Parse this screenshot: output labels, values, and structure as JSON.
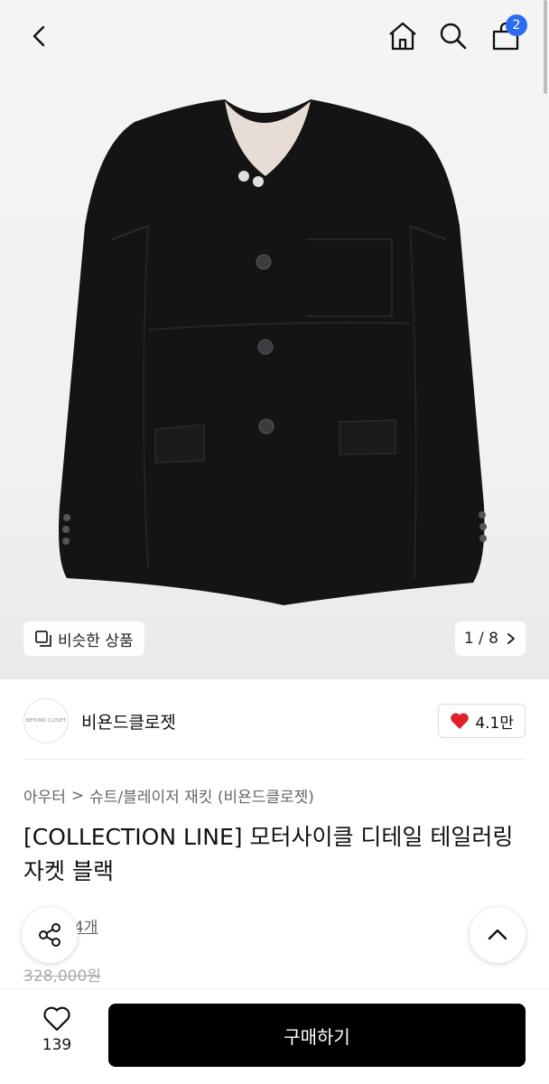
{
  "header": {
    "cart_count": "2"
  },
  "gallery": {
    "similar_label": "비슷한 상품",
    "pager": "1 / 8"
  },
  "brand": {
    "logo_text": "BEYOND CLOSET",
    "name": "비욘드클로젯",
    "likes": "4.1만"
  },
  "category": {
    "parent": "아우터",
    "separator": ">",
    "child": "슈트/블레이저 재킷 (비욘드클로젯)"
  },
  "product": {
    "title": "[COLLECTION LINE] 모터사이클 디테일 테일러링 자켓 블랙",
    "reviews_label": "후기 4개",
    "original_price": "328,000원"
  },
  "bottom_bar": {
    "wish_count": "139",
    "buy_label": "구매하기"
  },
  "colors": {
    "badge": "#2b6cf0",
    "heart": "#e0202a",
    "buy_button": "#000000"
  }
}
